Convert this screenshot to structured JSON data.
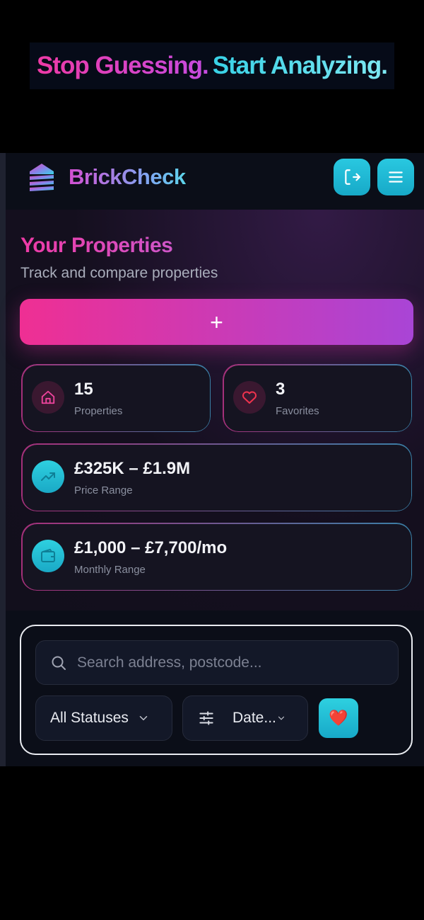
{
  "banner": {
    "part1": "Stop Guessing.",
    "part2": "Start Analyzing."
  },
  "header": {
    "brand": "BrickCheck",
    "logo_icon": "stacked-bricks-house-icon",
    "logout_icon": "logout-icon",
    "menu_icon": "hamburger-menu-icon"
  },
  "hero": {
    "title": "Your Properties",
    "subtitle": "Track and compare properties",
    "add_label": "+"
  },
  "stats": {
    "properties": {
      "value": "15",
      "label": "Properties",
      "icon": "house-icon"
    },
    "favorites": {
      "value": "3",
      "label": "Favorites",
      "icon": "heart-icon"
    },
    "price_range": {
      "value": "£325K – £1.9M",
      "label": "Price Range",
      "icon": "trending-up-icon"
    },
    "monthly_range": {
      "value": "£1,000 – £7,700/mo",
      "label": "Monthly Range",
      "icon": "wallet-icon"
    }
  },
  "filters": {
    "search_placeholder": "Search address, postcode...",
    "status_value": "All Statuses",
    "sort_value": "Date...",
    "favorite_emoji": "❤️"
  },
  "colors": {
    "accent_pink": "#ef2f93",
    "accent_purple": "#a945d6",
    "accent_cyan": "#29c8e0",
    "background": "#0b0e18"
  }
}
